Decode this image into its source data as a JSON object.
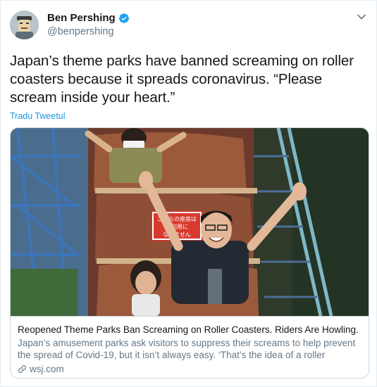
{
  "author": {
    "display_name": "Ben Pershing",
    "handle": "@benpershing",
    "verified": true
  },
  "tweet": {
    "text": "Japan’s theme parks have banned screaming on roller coasters because it spreads coronavirus. “Please scream inside your heart.”",
    "translate_label": "Tradu Tweetul"
  },
  "card": {
    "photo_sign": [
      "こちらの座席は",
      "ご利用に",
      "なれません"
    ],
    "title": "Reopened Theme Parks Ban Screaming on Roller Coasters. Riders Are Howling.",
    "description": "Japan’s amusement parks ask visitors to suppress their screams to help prevent the spread of Covid-19, but it isn’t always easy. ‘That’s the idea of a roller coaster…",
    "domain": "wsj.com"
  },
  "icons": {
    "verified": "verified-badge-icon",
    "menu": "chevron-down-icon",
    "link": "link-icon"
  },
  "colors": {
    "accent": "#1da1f2",
    "link": "#1b95e0",
    "secondary_text": "#657786",
    "border": "#ccd6dd"
  }
}
